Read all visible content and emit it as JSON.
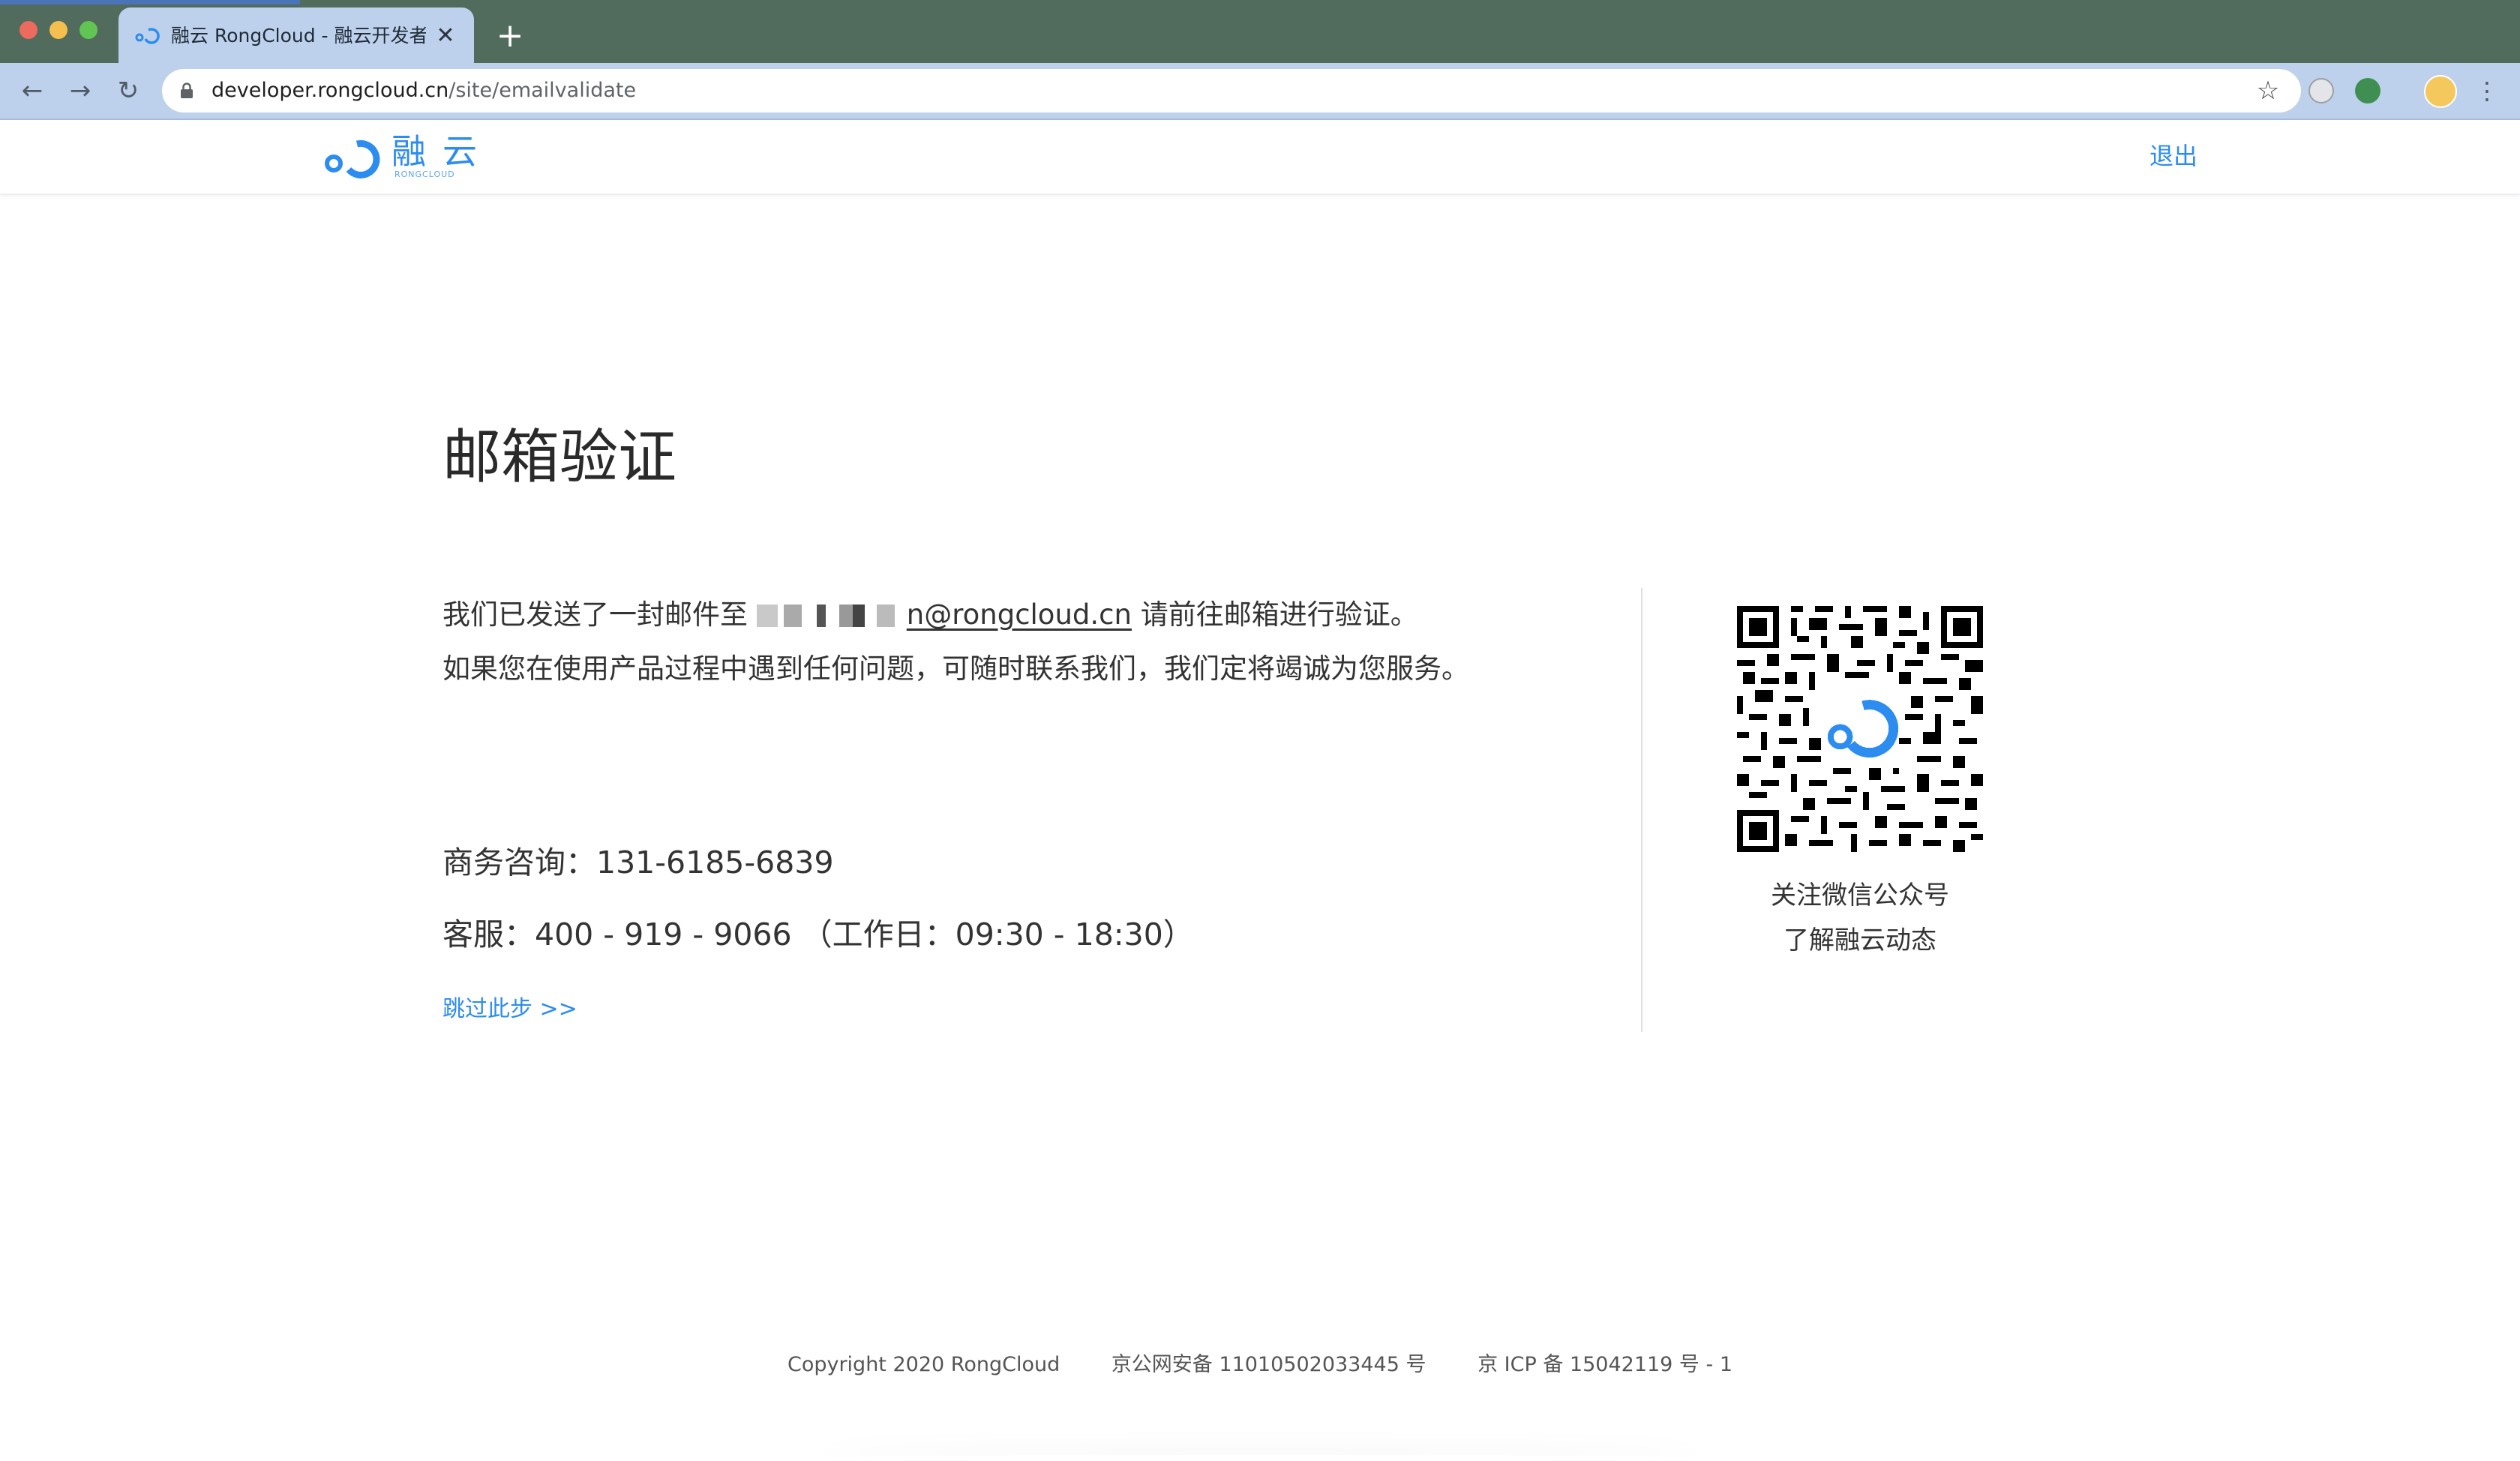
{
  "browser": {
    "tab_title": "融云 RongCloud - 融云开发者平台",
    "tab_close": "✕",
    "new_tab": "+",
    "url_host": "developer.rongcloud.cn",
    "url_path": "/site/emailvalidate",
    "icons": [
      "back-arrow-icon",
      "forward-arrow-icon",
      "reload-icon",
      "lock-icon",
      "star-icon",
      "extension-icon",
      "avatar-icon",
      "menu-icon"
    ]
  },
  "header": {
    "logo_text": "融云",
    "logo_sub": "RONGCLOUD",
    "logout": "退出"
  },
  "main": {
    "title": "邮箱验证",
    "sent_prefix": "我们已发送了一封邮件至",
    "email_visible": "n@rongcloud.cn",
    "sent_suffix": "请前往邮箱进行验证。",
    "help_text": "如果您在使用产品过程中遇到任何问题，可随时联系我们，我们定将竭诚为您服务。",
    "business": "商务咨询：131-6185-6839",
    "support": "客服：400 - 919 - 9066 （工作日：09:30 - 18:30）",
    "skip": "跳过此步 >>"
  },
  "qr": {
    "caption_line1": "关注微信公众号",
    "caption_line2": "了解融云动态"
  },
  "footer": {
    "copyright": "Copyright 2020 RongCloud",
    "police": "京公网安备 11010502033445 号",
    "icp": "京 ICP 备 15042119 号 - 1"
  },
  "colors": {
    "accent": "#2d8cef",
    "tab_strip": "#516b5c",
    "toolbar": "#bed1ec"
  }
}
